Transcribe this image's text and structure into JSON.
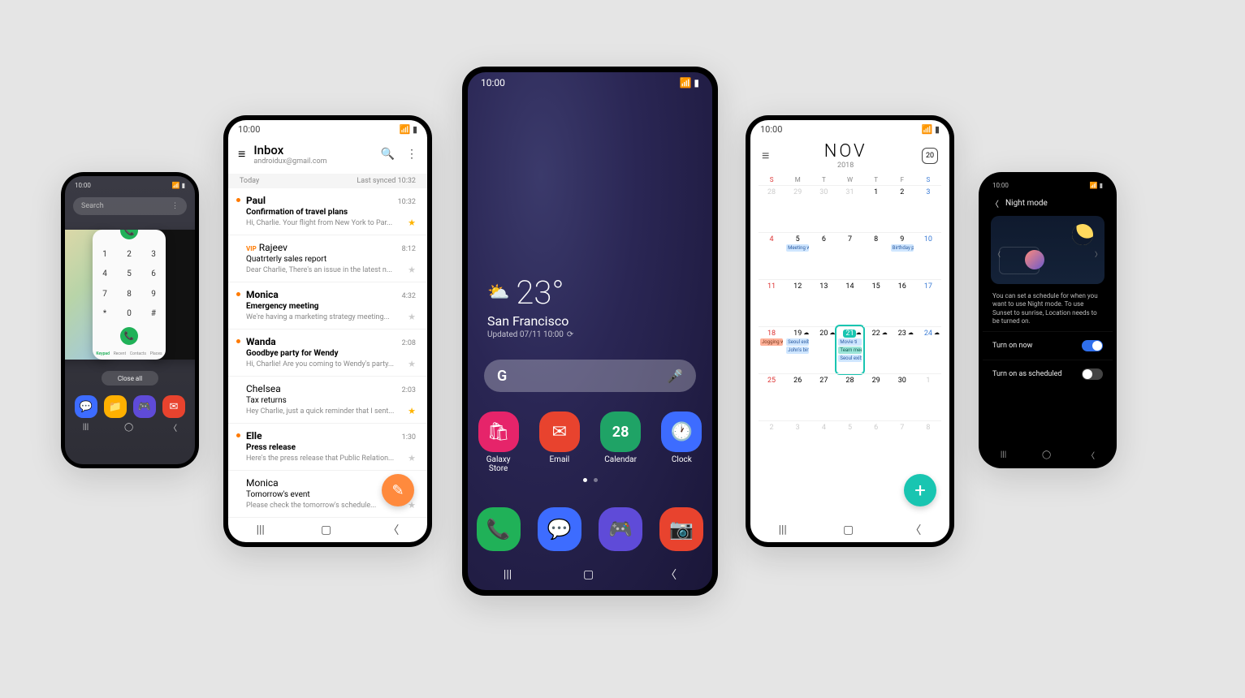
{
  "status": {
    "time": "10:00"
  },
  "recents": {
    "search_placeholder": "Search",
    "close_all": "Close all",
    "dial_keys": [
      "1",
      "2",
      "3",
      "4",
      "5",
      "6",
      "7",
      "8",
      "9",
      "*",
      "0",
      "#"
    ],
    "dial_tabs": [
      "Keypad",
      "Recent",
      "Contacts",
      "Places"
    ],
    "dock": [
      {
        "name": "messages",
        "color": "#3d6cff",
        "glyph": "💬"
      },
      {
        "name": "my-files",
        "color": "#ffb000",
        "glyph": "📁"
      },
      {
        "name": "game-launcher",
        "color": "#5f4bd8",
        "glyph": "🎮"
      },
      {
        "name": "gmail",
        "color": "#e8432e",
        "glyph": "✉"
      }
    ]
  },
  "email": {
    "title": "Inbox",
    "account": "androidux@gmail.com",
    "section": "Today",
    "last_synced": "Last synced 10:32",
    "messages": [
      {
        "from": "Paul",
        "time": "10:32",
        "subject": "Confirmation of travel plans",
        "preview": "Hi, Charlie. Your flight from New York to Par...",
        "unread": true,
        "starred": true,
        "vip": false
      },
      {
        "from": "Rajeev",
        "time": "8:12",
        "subject": "Quatrterly sales report",
        "preview": "Dear Charlie, There's an issue in the latest n...",
        "unread": false,
        "starred": false,
        "vip": true
      },
      {
        "from": "Monica",
        "time": "4:32",
        "subject": "Emergency meeting",
        "preview": "We're having a marketing strategy meeting...",
        "unread": true,
        "starred": false,
        "vip": false
      },
      {
        "from": "Wanda",
        "time": "2:08",
        "subject": "Goodbye party for Wendy",
        "preview": "Hi, Charlie! Are you coming to Wendy's party...",
        "unread": true,
        "starred": false,
        "vip": false
      },
      {
        "from": "Chelsea",
        "time": "2:03",
        "subject": "Tax returns",
        "preview": "Hey Charlie, just a quick reminder that I sent...",
        "unread": false,
        "starred": true,
        "vip": false
      },
      {
        "from": "Elle",
        "time": "1:30",
        "subject": "Press release",
        "preview": "Here's the press release that Public Relation...",
        "unread": true,
        "starred": false,
        "vip": false
      },
      {
        "from": "Monica",
        "time": "",
        "subject": "Tomorrow's event",
        "preview": "Please check the tomorrow's schedule...",
        "unread": false,
        "starred": false,
        "vip": false
      }
    ]
  },
  "home": {
    "temp": "23°",
    "city": "San Francisco",
    "updated": "Updated 07/11 10:00",
    "apps_row": [
      {
        "label": "Galaxy\nStore",
        "color": "#e6246a",
        "glyph": "🛍"
      },
      {
        "label": "Email",
        "color": "#e8432e",
        "glyph": "✉"
      },
      {
        "label": "Calendar",
        "color": "#1fa366",
        "glyph": "28"
      },
      {
        "label": "Clock",
        "color": "#3d6cff",
        "glyph": "🕐"
      }
    ],
    "dock": [
      {
        "label": "Phone",
        "color": "#20b158",
        "glyph": "📞"
      },
      {
        "label": "Messages",
        "color": "#3d6cff",
        "glyph": "💬"
      },
      {
        "label": "Game",
        "color": "#5f4bd8",
        "glyph": "🎮"
      },
      {
        "label": "Camera",
        "color": "#e8432e",
        "glyph": "📷"
      }
    ]
  },
  "calendar": {
    "month": "NOV",
    "year": "2018",
    "today_chip": "20",
    "dow": [
      "S",
      "M",
      "T",
      "W",
      "T",
      "F",
      "S"
    ],
    "weeks": [
      [
        {
          "n": "28",
          "dim": true
        },
        {
          "n": "29",
          "dim": true
        },
        {
          "n": "30",
          "dim": true
        },
        {
          "n": "31",
          "dim": true
        },
        {
          "n": "1"
        },
        {
          "n": "2"
        },
        {
          "n": "3"
        }
      ],
      [
        {
          "n": "4"
        },
        {
          "n": "5",
          "ev": [
            {
              "t": "Meeting w",
              "c": "blue"
            }
          ]
        },
        {
          "n": "6"
        },
        {
          "n": "7"
        },
        {
          "n": "8"
        },
        {
          "n": "9",
          "ev": [
            {
              "t": "Birthday p",
              "c": "blue"
            }
          ]
        },
        {
          "n": "10"
        }
      ],
      [
        {
          "n": "11",
          "sun": true
        },
        {
          "n": "12"
        },
        {
          "n": "13"
        },
        {
          "n": "14"
        },
        {
          "n": "15"
        },
        {
          "n": "16"
        },
        {
          "n": "17"
        }
      ],
      [
        {
          "n": "18",
          "sun": true,
          "ev": [
            {
              "t": "Jogging with my fam",
              "c": "coral"
            }
          ]
        },
        {
          "n": "19",
          "ev": [
            {
              "t": "Seoul exib",
              "c": "blue"
            },
            {
              "t": "John's birt",
              "c": "blue"
            }
          ],
          "w": "☁"
        },
        {
          "n": "20",
          "w": "☁"
        },
        {
          "n": "21",
          "today": true,
          "ev": [
            {
              "t": "Movie ti",
              "c": "blue"
            },
            {
              "t": "Team mee",
              "c": "teal"
            },
            {
              "t": "Seoul exib",
              "c": "blue"
            }
          ],
          "w": "☁"
        },
        {
          "n": "22",
          "w": "☁"
        },
        {
          "n": "23",
          "w": "☁"
        },
        {
          "n": "24",
          "w": "☁"
        }
      ],
      [
        {
          "n": "25",
          "sun": true
        },
        {
          "n": "26"
        },
        {
          "n": "27"
        },
        {
          "n": "28"
        },
        {
          "n": "29"
        },
        {
          "n": "30"
        },
        {
          "n": "1",
          "dim": true
        }
      ],
      [
        {
          "n": "2",
          "dim": true
        },
        {
          "n": "3",
          "dim": true
        },
        {
          "n": "4",
          "dim": true
        },
        {
          "n": "5",
          "dim": true
        },
        {
          "n": "6",
          "dim": true
        },
        {
          "n": "7",
          "dim": true
        },
        {
          "n": "8",
          "dim": true
        }
      ]
    ]
  },
  "nightmode": {
    "title": "Night mode",
    "desc": "You can set a schedule for when you want to use Night mode. To use Sunset to sunrise, Location needs to be turned on.",
    "row1": "Turn on now",
    "row2": "Turn on as scheduled"
  }
}
